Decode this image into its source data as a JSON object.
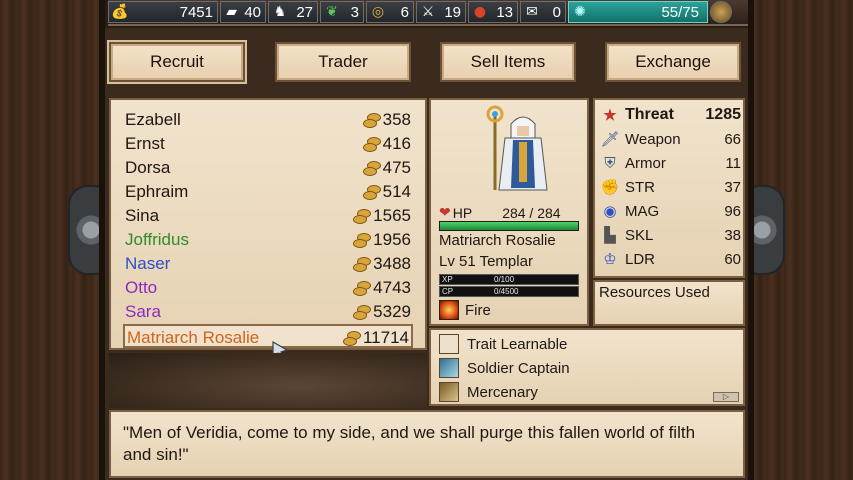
{
  "resources": [
    {
      "id": "gold",
      "icon": "coins-icon",
      "glyph": "💰",
      "value": "7451"
    },
    {
      "id": "iron",
      "icon": "iron-icon",
      "glyph": "▰",
      "value": "40"
    },
    {
      "id": "horse",
      "icon": "horse-icon",
      "glyph": "♞",
      "value": "27"
    },
    {
      "id": "herb",
      "icon": "herb-icon",
      "glyph": "❦",
      "value": "3"
    },
    {
      "id": "gem",
      "icon": "gem-icon",
      "glyph": "◎",
      "value": "6"
    },
    {
      "id": "sword",
      "icon": "sword-icon",
      "glyph": "⚔",
      "value": "19"
    },
    {
      "id": "ore",
      "icon": "ore-icon",
      "glyph": "●",
      "value": "13"
    },
    {
      "id": "scroll",
      "icon": "scroll-icon",
      "glyph": "✉",
      "value": "0"
    }
  ],
  "population": {
    "value": "55/75",
    "icon": "population-icon",
    "glyph": "✺"
  },
  "tabs": {
    "recruit": "Recruit",
    "trader": "Trader",
    "sell": "Sell Items",
    "exchange": "Exchange"
  },
  "recruits": [
    {
      "name": "Ezabell",
      "cost": "358",
      "color": "#1f1712"
    },
    {
      "name": "Ernst",
      "cost": "416",
      "color": "#1f1712"
    },
    {
      "name": "Dorsa",
      "cost": "475",
      "color": "#1f1712"
    },
    {
      "name": "Ephraim",
      "cost": "514",
      "color": "#1f1712"
    },
    {
      "name": "Sina",
      "cost": "1565",
      "color": "#1f1712"
    },
    {
      "name": "Joffridus",
      "cost": "1956",
      "color": "#2e8b2e"
    },
    {
      "name": "Naser",
      "cost": "3488",
      "color": "#2b4fc9"
    },
    {
      "name": "Otto",
      "cost": "4743",
      "color": "#8a2bbf"
    },
    {
      "name": "Sara",
      "cost": "5329",
      "color": "#8a2bbf"
    },
    {
      "name": "Matriarch Rosalie",
      "cost": "11714",
      "color": "#d0641e"
    }
  ],
  "character": {
    "hp_label": "HP",
    "hp": "284 / 284",
    "hp_fraction": 1.0,
    "name": "Matriarch Rosalie",
    "class": "Lv 51 Templar",
    "xp_label": "XP",
    "xp": "0/100",
    "cp_label": "CP",
    "cp": "0/4500",
    "element": "Fire"
  },
  "stats": [
    {
      "label": "Threat",
      "value": "1285",
      "icon": "star-icon",
      "glyph": "★",
      "color": "#c0392b"
    },
    {
      "label": "Weapon",
      "value": "66",
      "icon": "sword-icon",
      "glyph": "🗡",
      "color": "#3a5a8a"
    },
    {
      "label": "Armor",
      "value": "11",
      "icon": "armor-icon",
      "glyph": "⛨",
      "color": "#3a5a8a"
    },
    {
      "label": "STR",
      "value": "37",
      "icon": "arm-icon",
      "glyph": "✊",
      "color": "#c77a5a"
    },
    {
      "label": "MAG",
      "value": "96",
      "icon": "orb-icon",
      "glyph": "◉",
      "color": "#2b4fc9"
    },
    {
      "label": "SKL",
      "value": "38",
      "icon": "boot-icon",
      "glyph": "▙",
      "color": "#555"
    },
    {
      "label": "LDR",
      "value": "60",
      "icon": "leader-icon",
      "glyph": "♔",
      "color": "#2b4fc9"
    }
  ],
  "resources_used_label": "Resources Used",
  "traits": [
    {
      "label": "Trait Learnable",
      "icon": "empty-trait-icon",
      "kind": "empty"
    },
    {
      "label": "Soldier Captain",
      "icon": "captain-icon",
      "kind": "captain"
    },
    {
      "label": "Mercenary",
      "icon": "mercenary-icon",
      "kind": "merc"
    }
  ],
  "dialogue": "\"Men of Veridia, come to my side, and we shall purge this fallen world of filth and sin!\""
}
